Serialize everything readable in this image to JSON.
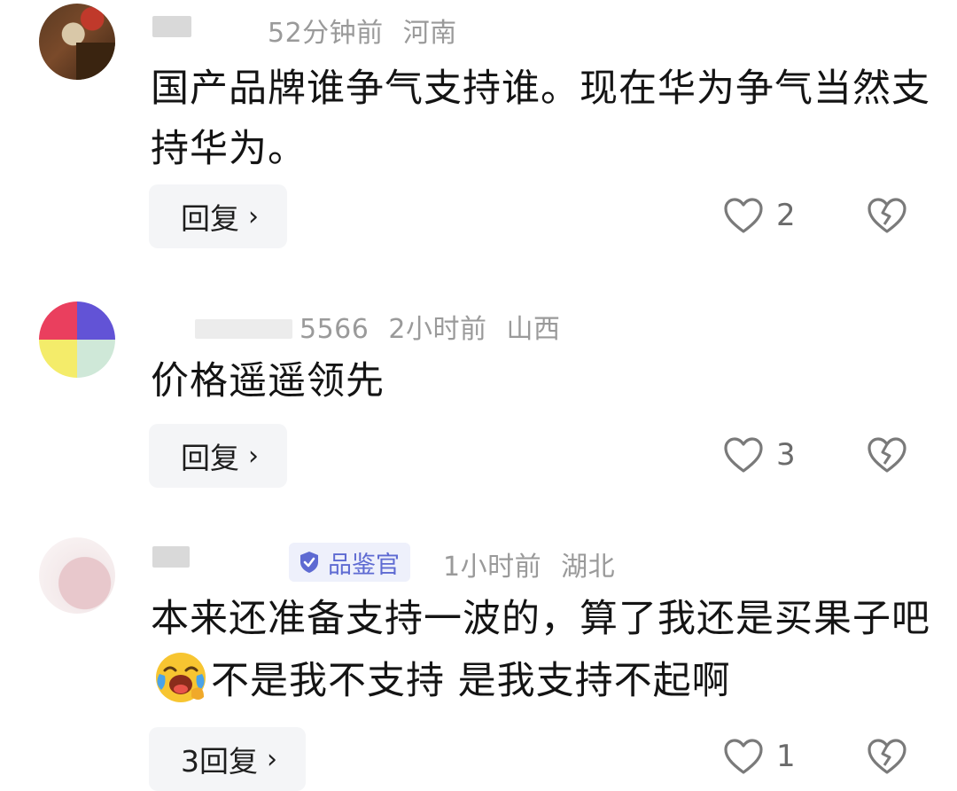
{
  "comments": [
    {
      "meta": {
        "time": "52分钟前",
        "location": "河南"
      },
      "text": "国产品牌谁争气支持谁。现在华为争气当然支持华为。",
      "reply_label": "回复",
      "likes": "2"
    },
    {
      "meta": {
        "name_tail": "5566",
        "time": "2小时前",
        "location": "山西"
      },
      "text": "价格遥遥领先",
      "reply_label": "回复",
      "likes": "3"
    },
    {
      "meta": {
        "badge": "品鉴官",
        "time": "1小时前",
        "location": "湖北"
      },
      "text_before_emoji": "本来还准备支持一波的，算了我还是买果子吧",
      "text_after_emoji": "不是我不支持 是我支持不起啊",
      "emoji": "laughing-crying-emoji",
      "reply_label": "3回复",
      "likes": "1"
    }
  ],
  "colors": {
    "badge": "#5e6ad2",
    "meta": "#9a9a9a",
    "reply_bg": "#f4f5f7"
  },
  "icons": [
    "heart-outline-icon",
    "broken-heart-icon",
    "chevron-right-icon",
    "verified-check-icon"
  ]
}
